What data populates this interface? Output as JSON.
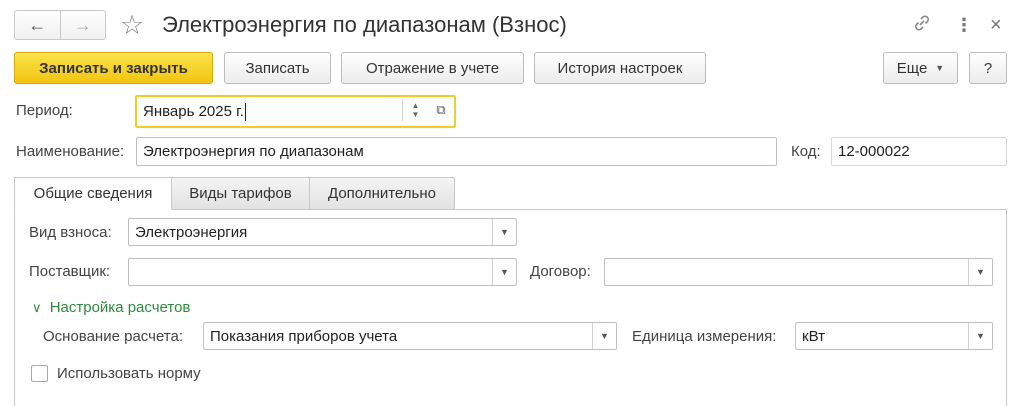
{
  "window": {
    "title": "Электроэнергия по диапазонам (Взнос)",
    "back_icon": "←",
    "forward_icon": "→",
    "star_icon": "☆",
    "link_icon": "🔗",
    "more_icon": "⋮",
    "close_icon": "×"
  },
  "toolbar": {
    "save_close": "Записать и закрыть",
    "save": "Записать",
    "accounting": "Отражение в учете",
    "history": "История настроек",
    "more": "Еще",
    "help": "?"
  },
  "header": {
    "period_label": "Период:",
    "period_value": "Январь 2025 г.",
    "name_label": "Наименование:",
    "name_value": "Электроэнергия по диапазонам",
    "code_label": "Код:",
    "code_value": "12-000022"
  },
  "tabs": [
    {
      "label": "Общие сведения",
      "active": true
    },
    {
      "label": "Виды тарифов",
      "active": false
    },
    {
      "label": "Дополнительно",
      "active": false
    }
  ],
  "general": {
    "fee_type_label": "Вид взноса:",
    "fee_type_value": "Электроэнергия",
    "supplier_label": "Поставщик:",
    "supplier_value": "",
    "contract_label": "Договор:",
    "contract_value": "",
    "calc_group_title": "Настройка расчетов",
    "calc_basis_label": "Основание расчета:",
    "calc_basis_value": "Показания приборов учета",
    "unit_label": "Единица измерения:",
    "unit_value": "кВт",
    "use_norm_label": "Использовать норму",
    "use_norm_checked": false
  },
  "colors": {
    "primary_button": "#f1c40f",
    "focus_border": "#f2cc2d",
    "group_title": "#2e8b3e"
  }
}
